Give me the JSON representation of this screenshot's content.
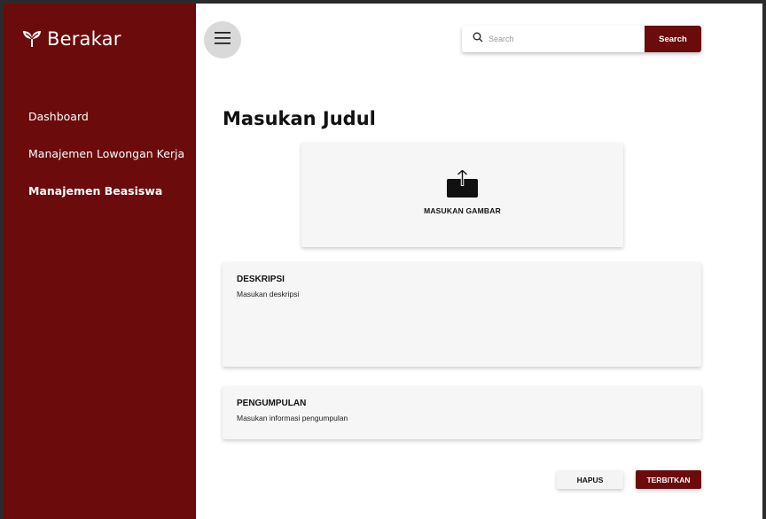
{
  "sidebar": {
    "logo_text": "Berakar",
    "items": [
      {
        "label": "Dashboard",
        "active": false
      },
      {
        "label": "Manajemen Lowongan Kerja",
        "active": false
      },
      {
        "label": "Manajemen Beasiswa",
        "active": true
      }
    ]
  },
  "header": {
    "menu_icon": "hamburger-icon",
    "search": {
      "placeholder": "Search",
      "value": "",
      "button_label": "Search",
      "icon": "search-icon"
    }
  },
  "main": {
    "title": "Masukan Judul",
    "upload": {
      "label": "MASUKAN GAMBAR",
      "icon": "upload-icon"
    },
    "deskripsi": {
      "label": "DESKRIPSI",
      "placeholder": "Masukan deskripsi"
    },
    "pengumpulan": {
      "label": "PENGUMPULAN",
      "placeholder": "Masukan informasi pengumpulan"
    }
  },
  "actions": {
    "delete_label": "HAPUS",
    "publish_label": "TERBITKAN"
  },
  "colors": {
    "brand": "#6b0b0b",
    "card_bg": "#f6f6f6",
    "menu_circle": "#d9d9d9"
  }
}
